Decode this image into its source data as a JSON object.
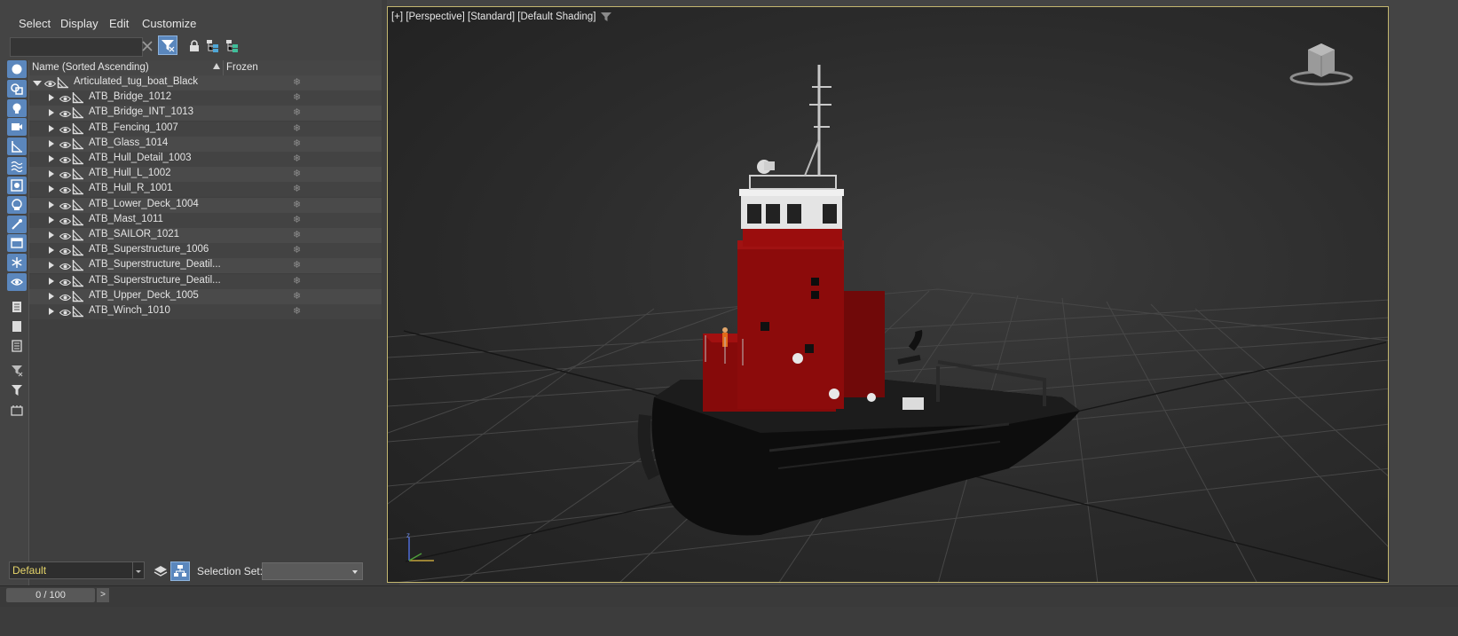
{
  "menu": {
    "items": [
      "Select",
      "Display",
      "Edit",
      "Customize"
    ]
  },
  "explorer": {
    "search": {
      "value": "",
      "placeholder": ""
    },
    "columns": {
      "name": "Name (Sorted Ascending)",
      "frozen": "Frozen"
    },
    "root": {
      "label": "Articulated_tug_boat_Black",
      "expanded": true
    },
    "children": [
      "ATB_Bridge_1012",
      "ATB_Bridge_INT_1013",
      "ATB_Fencing_1007",
      "ATB_Glass_1014",
      "ATB_Hull_Detail_1003",
      "ATB_Hull_L_1002",
      "ATB_Hull_R_1001",
      "ATB_Lower_Deck_1004",
      "ATB_Mast_1011",
      "ATB_SAILOR_1021",
      "ATB_Superstructure_1006",
      "ATB_Superstructure_Deatil...",
      "ATB_Superstructure_Deatil...",
      "ATB_Upper_Deck_1005",
      "ATB_Winch_1010"
    ],
    "frozen_symbol": "❄",
    "layer": "Default",
    "selection_set_label": "Selection Set:",
    "selection_set_value": ""
  },
  "timeline": {
    "frame": "0 / 100",
    "next_label": ">"
  },
  "viewport": {
    "label_parts": [
      "[+]",
      "[Perspective]",
      "[Standard]",
      "[Default Shading]"
    ],
    "axis_label": "z",
    "colors": {
      "hull": "#0e0e0e",
      "superstructure": "#8f0b0b",
      "bridge": "#e8e8e8",
      "grid": "#4d4d4d",
      "border_active": "#c4b770"
    }
  },
  "icons": {
    "side": [
      "sphere-icon",
      "shapes-icon",
      "light-icon",
      "camera-icon",
      "helper-icon",
      "spacewarp-icon",
      "group-icon",
      "xref-icon",
      "bone-icon",
      "container-icon",
      "frozen-icon",
      "hidden-icon",
      "list-icon",
      "list-empty-icon",
      "list-lines-icon",
      "filter-clear-icon",
      "filter-icon",
      "layer-icon"
    ]
  }
}
